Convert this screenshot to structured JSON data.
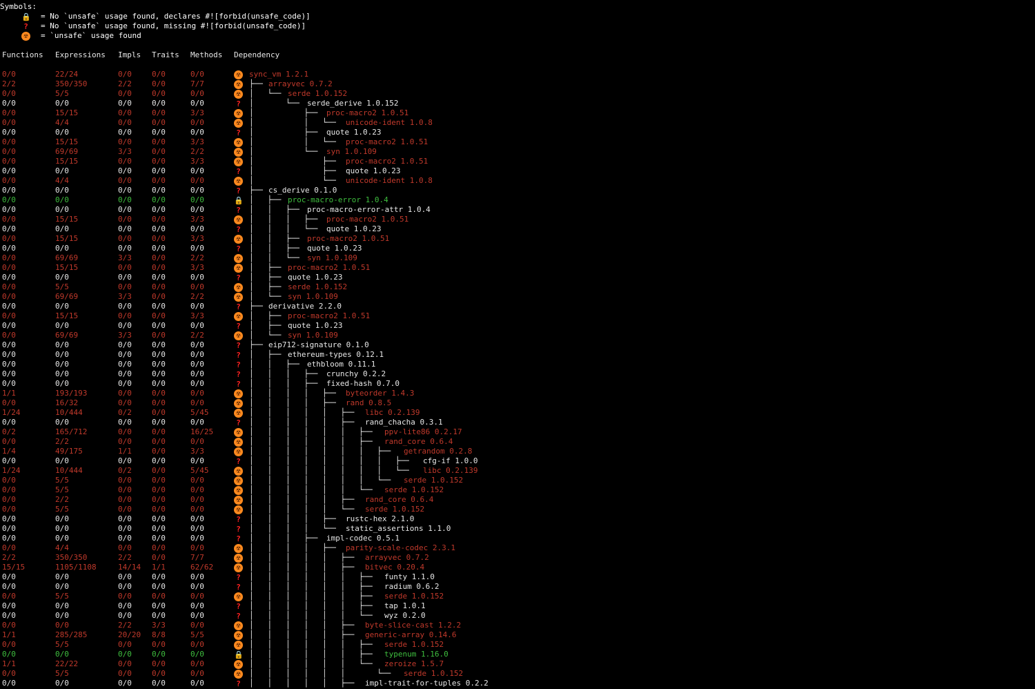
{
  "legend": {
    "title": "Symbols:",
    "items": [
      {
        "icon": "lock-icon",
        "text": "= No `unsafe` usage found, declares #![forbid(unsafe_code)]"
      },
      {
        "icon": "question-icon",
        "text": "= No `unsafe` usage found, missing #![forbid(unsafe_code)]"
      },
      {
        "icon": "radioactive-icon",
        "text": "= `unsafe` usage found"
      }
    ]
  },
  "headers": [
    "Functions",
    "Expressions",
    "Impls",
    "Traits",
    "Methods",
    "Dependency"
  ],
  "colors": {
    "unsafe": "#c0392b",
    "forbid": "#3fbf3f",
    "none": "#e8e8e8",
    "radioactive_bg": "#ff8a1f",
    "question": "#ff2222"
  },
  "rows": [
    [
      "0/0",
      "22/24",
      "0/0",
      "0/0",
      "0/0",
      "r",
      0,
      "sync_vm 1.2.1"
    ],
    [
      "2/2",
      "350/350",
      "2/2",
      "0/0",
      "7/7",
      "r",
      1,
      "arrayvec 0.7.2"
    ],
    [
      "0/0",
      "5/5",
      "0/0",
      "0/0",
      "0/0",
      "r",
      2,
      "serde 1.0.152"
    ],
    [
      "0/0",
      "0/0",
      "0/0",
      "0/0",
      "0/0",
      "q",
      3,
      "serde_derive 1.0.152"
    ],
    [
      "0/0",
      "15/15",
      "0/0",
      "0/0",
      "3/3",
      "r",
      4,
      "proc-macro2 1.0.51"
    ],
    [
      "0/0",
      "4/4",
      "0/0",
      "0/0",
      "0/0",
      "r",
      5,
      "unicode-ident 1.0.8"
    ],
    [
      "0/0",
      "0/0",
      "0/0",
      "0/0",
      "0/0",
      "q",
      4,
      "quote 1.0.23"
    ],
    [
      "0/0",
      "15/15",
      "0/0",
      "0/0",
      "3/3",
      "r",
      5,
      "proc-macro2 1.0.51"
    ],
    [
      "0/0",
      "69/69",
      "3/3",
      "0/0",
      "2/2",
      "r",
      4,
      "syn 1.0.109"
    ],
    [
      "0/0",
      "15/15",
      "0/0",
      "0/0",
      "3/3",
      "r",
      5,
      "proc-macro2 1.0.51"
    ],
    [
      "0/0",
      "0/0",
      "0/0",
      "0/0",
      "0/0",
      "q",
      5,
      "quote 1.0.23"
    ],
    [
      "0/0",
      "4/4",
      "0/0",
      "0/0",
      "0/0",
      "r",
      5,
      "unicode-ident 1.0.8"
    ],
    [
      "0/0",
      "0/0",
      "0/0",
      "0/0",
      "0/0",
      "q",
      1,
      "cs_derive 0.1.0"
    ],
    [
      "0/0",
      "0/0",
      "0/0",
      "0/0",
      "0/0",
      "l",
      2,
      "proc-macro-error 1.0.4"
    ],
    [
      "0/0",
      "0/0",
      "0/0",
      "0/0",
      "0/0",
      "q",
      3,
      "proc-macro-error-attr 1.0.4"
    ],
    [
      "0/0",
      "15/15",
      "0/0",
      "0/0",
      "3/3",
      "r",
      4,
      "proc-macro2 1.0.51"
    ],
    [
      "0/0",
      "0/0",
      "0/0",
      "0/0",
      "0/0",
      "q",
      4,
      "quote 1.0.23"
    ],
    [
      "0/0",
      "15/15",
      "0/0",
      "0/0",
      "3/3",
      "r",
      3,
      "proc-macro2 1.0.51"
    ],
    [
      "0/0",
      "0/0",
      "0/0",
      "0/0",
      "0/0",
      "q",
      3,
      "quote 1.0.23"
    ],
    [
      "0/0",
      "69/69",
      "3/3",
      "0/0",
      "2/2",
      "r",
      3,
      "syn 1.0.109"
    ],
    [
      "0/0",
      "15/15",
      "0/0",
      "0/0",
      "3/3",
      "r",
      2,
      "proc-macro2 1.0.51"
    ],
    [
      "0/0",
      "0/0",
      "0/0",
      "0/0",
      "0/0",
      "q",
      2,
      "quote 1.0.23"
    ],
    [
      "0/0",
      "5/5",
      "0/0",
      "0/0",
      "0/0",
      "r",
      2,
      "serde 1.0.152"
    ],
    [
      "0/0",
      "69/69",
      "3/3",
      "0/0",
      "2/2",
      "r",
      2,
      "syn 1.0.109"
    ],
    [
      "0/0",
      "0/0",
      "0/0",
      "0/0",
      "0/0",
      "q",
      1,
      "derivative 2.2.0"
    ],
    [
      "0/0",
      "15/15",
      "0/0",
      "0/0",
      "3/3",
      "r",
      2,
      "proc-macro2 1.0.51"
    ],
    [
      "0/0",
      "0/0",
      "0/0",
      "0/0",
      "0/0",
      "q",
      2,
      "quote 1.0.23"
    ],
    [
      "0/0",
      "69/69",
      "3/3",
      "0/0",
      "2/2",
      "r",
      2,
      "syn 1.0.109"
    ],
    [
      "0/0",
      "0/0",
      "0/0",
      "0/0",
      "0/0",
      "q",
      1,
      "eip712-signature 0.1.0"
    ],
    [
      "0/0",
      "0/0",
      "0/0",
      "0/0",
      "0/0",
      "q",
      2,
      "ethereum-types 0.12.1"
    ],
    [
      "0/0",
      "0/0",
      "0/0",
      "0/0",
      "0/0",
      "q",
      3,
      "ethbloom 0.11.1"
    ],
    [
      "0/0",
      "0/0",
      "0/0",
      "0/0",
      "0/0",
      "q",
      4,
      "crunchy 0.2.2"
    ],
    [
      "0/0",
      "0/0",
      "0/0",
      "0/0",
      "0/0",
      "q",
      4,
      "fixed-hash 0.7.0"
    ],
    [
      "1/1",
      "193/193",
      "0/0",
      "0/0",
      "0/0",
      "r",
      5,
      "byteorder 1.4.3"
    ],
    [
      "0/0",
      "16/32",
      "0/0",
      "0/0",
      "0/0",
      "r",
      5,
      "rand 0.8.5"
    ],
    [
      "1/24",
      "10/444",
      "0/2",
      "0/0",
      "5/45",
      "r",
      6,
      "libc 0.2.139"
    ],
    [
      "0/0",
      "0/0",
      "0/0",
      "0/0",
      "0/0",
      "q",
      6,
      "rand_chacha 0.3.1"
    ],
    [
      "0/2",
      "165/712",
      "0/0",
      "0/0",
      "16/25",
      "r",
      7,
      "ppv-lite86 0.2.17"
    ],
    [
      "0/0",
      "2/2",
      "0/0",
      "0/0",
      "0/0",
      "r",
      7,
      "rand_core 0.6.4"
    ],
    [
      "1/4",
      "49/175",
      "1/1",
      "0/0",
      "3/3",
      "r",
      8,
      "getrandom 0.2.8"
    ],
    [
      "0/0",
      "0/0",
      "0/0",
      "0/0",
      "0/0",
      "q",
      9,
      "cfg-if 1.0.0"
    ],
    [
      "1/24",
      "10/444",
      "0/2",
      "0/0",
      "5/45",
      "r",
      9,
      "libc 0.2.139"
    ],
    [
      "0/0",
      "5/5",
      "0/0",
      "0/0",
      "0/0",
      "r",
      8,
      "serde 1.0.152"
    ],
    [
      "0/0",
      "5/5",
      "0/0",
      "0/0",
      "0/0",
      "r",
      7,
      "serde 1.0.152"
    ],
    [
      "0/0",
      "2/2",
      "0/0",
      "0/0",
      "0/0",
      "r",
      6,
      "rand_core 0.6.4"
    ],
    [
      "0/0",
      "5/5",
      "0/0",
      "0/0",
      "0/0",
      "r",
      6,
      "serde 1.0.152"
    ],
    [
      "0/0",
      "0/0",
      "0/0",
      "0/0",
      "0/0",
      "q",
      5,
      "rustc-hex 2.1.0"
    ],
    [
      "0/0",
      "0/0",
      "0/0",
      "0/0",
      "0/0",
      "q",
      5,
      "static_assertions 1.1.0"
    ],
    [
      "0/0",
      "0/0",
      "0/0",
      "0/0",
      "0/0",
      "q",
      4,
      "impl-codec 0.5.1"
    ],
    [
      "0/0",
      "4/4",
      "0/0",
      "0/0",
      "0/0",
      "r",
      5,
      "parity-scale-codec 2.3.1"
    ],
    [
      "2/2",
      "350/350",
      "2/2",
      "0/0",
      "7/7",
      "r",
      6,
      "arrayvec 0.7.2"
    ],
    [
      "15/15",
      "1105/1108",
      "14/14",
      "1/1",
      "62/62",
      "r",
      6,
      "bitvec 0.20.4"
    ],
    [
      "0/0",
      "0/0",
      "0/0",
      "0/0",
      "0/0",
      "q",
      7,
      "funty 1.1.0"
    ],
    [
      "0/0",
      "0/0",
      "0/0",
      "0/0",
      "0/0",
      "q",
      7,
      "radium 0.6.2"
    ],
    [
      "0/0",
      "5/5",
      "0/0",
      "0/0",
      "0/0",
      "r",
      7,
      "serde 1.0.152"
    ],
    [
      "0/0",
      "0/0",
      "0/0",
      "0/0",
      "0/0",
      "q",
      7,
      "tap 1.0.1"
    ],
    [
      "0/0",
      "0/0",
      "0/0",
      "0/0",
      "0/0",
      "q",
      7,
      "wyz 0.2.0"
    ],
    [
      "0/0",
      "0/0",
      "2/2",
      "3/3",
      "0/0",
      "r",
      6,
      "byte-slice-cast 1.2.2"
    ],
    [
      "1/1",
      "285/285",
      "20/20",
      "8/8",
      "5/5",
      "r",
      6,
      "generic-array 0.14.6"
    ],
    [
      "0/0",
      "5/5",
      "0/0",
      "0/0",
      "0/0",
      "r",
      7,
      "serde 1.0.152"
    ],
    [
      "0/0",
      "0/0",
      "0/0",
      "0/0",
      "0/0",
      "l",
      7,
      "typenum 1.16.0"
    ],
    [
      "1/1",
      "22/22",
      "0/0",
      "0/0",
      "0/0",
      "r",
      7,
      "zeroize 1.5.7"
    ],
    [
      "0/0",
      "5/5",
      "0/0",
      "0/0",
      "0/0",
      "r",
      8,
      "serde 1.0.152"
    ],
    [
      "0/0",
      "0/0",
      "0/0",
      "0/0",
      "0/0",
      "q",
      6,
      "impl-trait-for-tuples 0.2.2"
    ]
  ]
}
